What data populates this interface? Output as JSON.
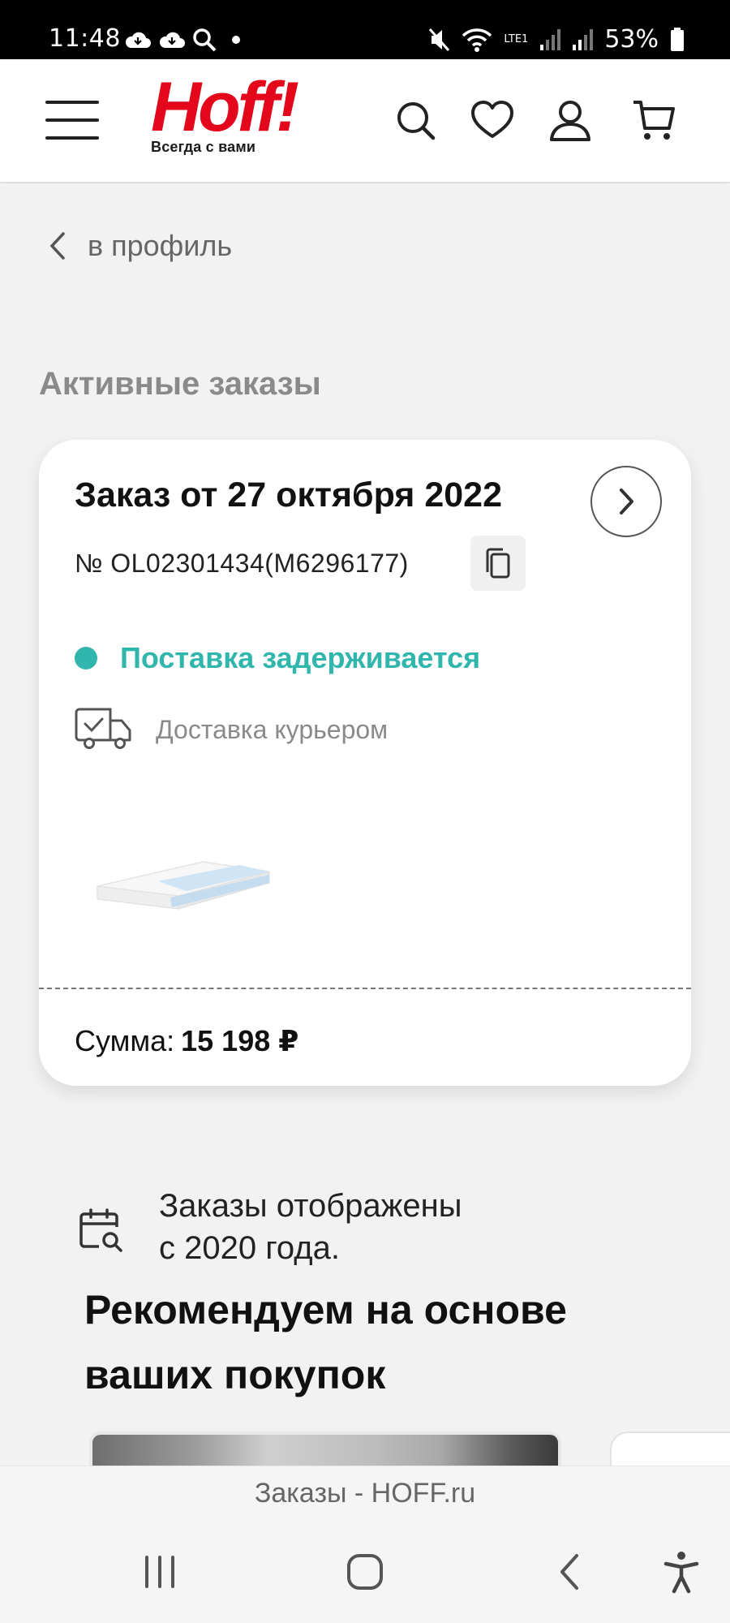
{
  "status_bar": {
    "time": "11:48",
    "battery": "53%",
    "network": "LTE1"
  },
  "header": {
    "logo_text": "Hoff",
    "logo_excl": "!",
    "logo_tagline": "Всегда с вами",
    "icons": [
      "menu-icon",
      "search-icon",
      "heart-icon",
      "user-icon",
      "cart-icon"
    ]
  },
  "back": {
    "label": "в профиль"
  },
  "section": {
    "title": "Активные заказы"
  },
  "order": {
    "title": "Заказ от 27 октября 2022",
    "number": "№ OL02301434(M6296177)",
    "status": "Поставка задерживается",
    "delivery": "Доставка курьером",
    "sum_label": "Сумма:",
    "sum_value": "15 198 ₽",
    "status_color": "#31b6ad"
  },
  "info": {
    "line1": "Заказы отображены",
    "line2": "с 2020 года."
  },
  "recommend": {
    "line1": "Рекомендуем на основе",
    "line2": "ваших покупок"
  },
  "footer": {
    "caption": "Заказы - HOFF.ru"
  },
  "colors": {
    "brand": "#e4061a",
    "accent": "#31b6ad"
  }
}
